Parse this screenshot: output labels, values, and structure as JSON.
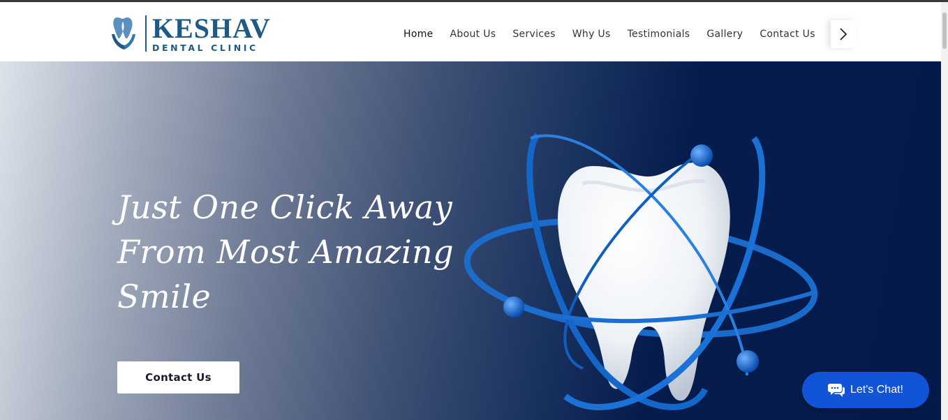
{
  "brand": {
    "name": "KESHAV",
    "subtitle": "DENTAL CLINIC",
    "color": "#1d5a86"
  },
  "nav": {
    "items": [
      {
        "label": "Home",
        "active": true
      },
      {
        "label": "About Us"
      },
      {
        "label": "Services"
      },
      {
        "label": "Why Us"
      },
      {
        "label": "Testimonials"
      },
      {
        "label": "Gallery"
      },
      {
        "label": "Contact Us"
      }
    ],
    "next_icon": "chevron-right-icon"
  },
  "hero": {
    "headline_lines": [
      "Just One Click Away",
      "From Most Amazing",
      "Smile"
    ],
    "cta_label": "Contact Us",
    "image_icon": "tooth-atom-illustration"
  },
  "chat": {
    "label": "Let's Chat!",
    "icon": "chat-bubble-icon",
    "color": "#1254d8"
  }
}
